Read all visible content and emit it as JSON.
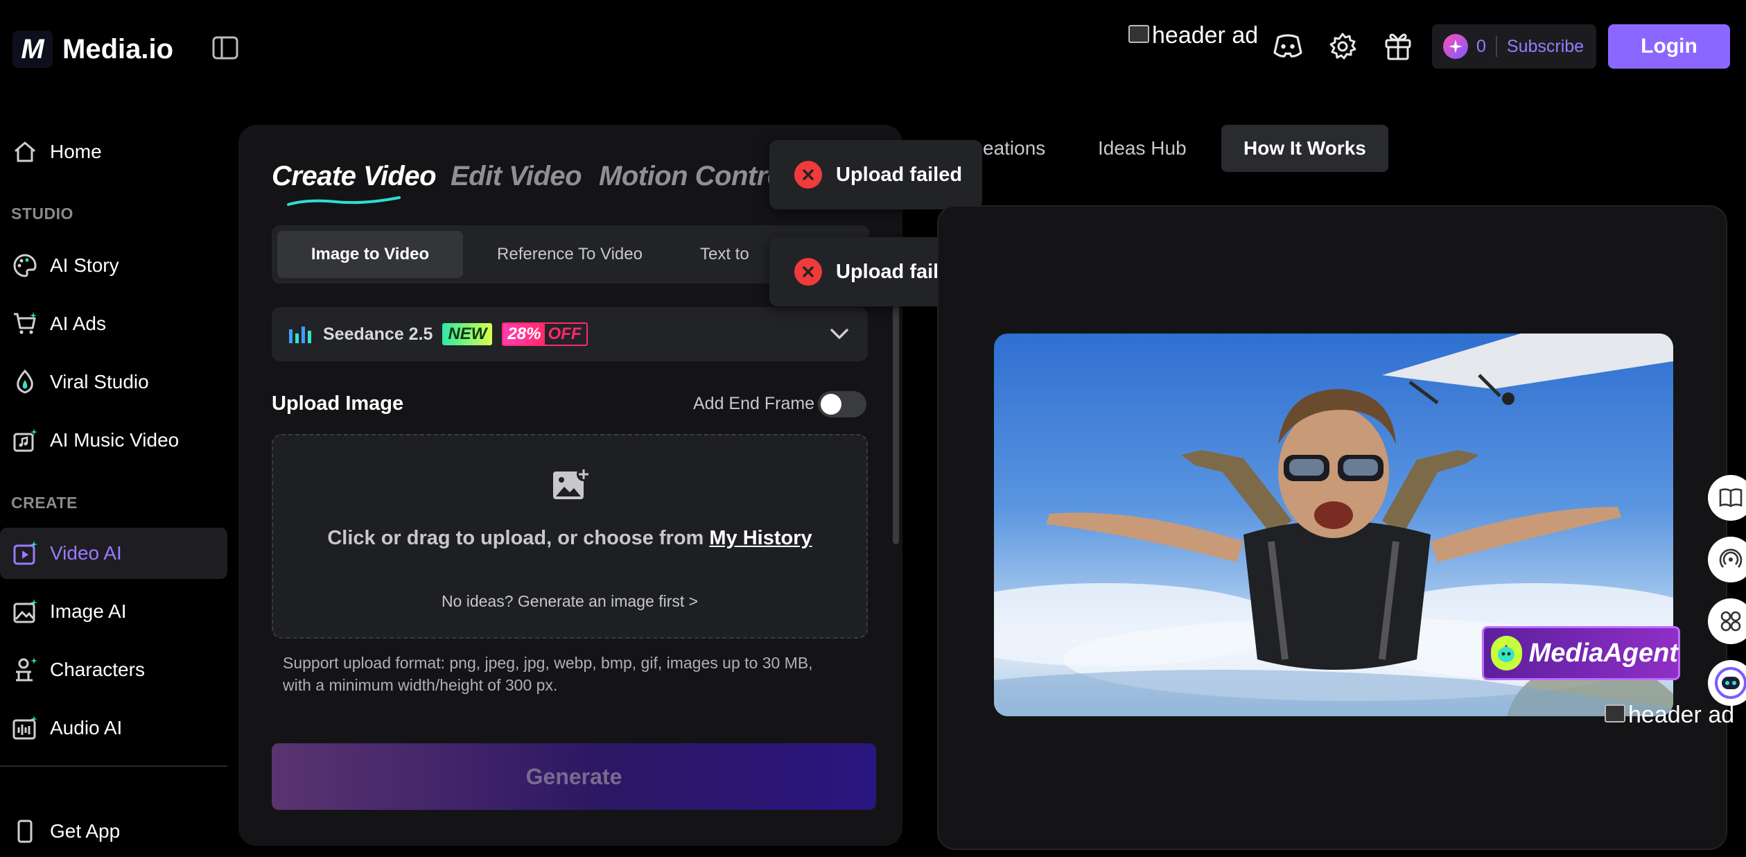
{
  "header": {
    "brand": "Media.io",
    "logo_glyph": "M",
    "ad_alt": "header ad",
    "credits": "0",
    "subscribe": "Subscribe",
    "login": "Login"
  },
  "sidebar": {
    "items_top": [
      {
        "label": "Home",
        "icon": "home-icon"
      }
    ],
    "section_studio": "STUDIO",
    "studio_items": [
      {
        "label": "AI Story",
        "icon": "palette-icon"
      },
      {
        "label": "AI Ads",
        "icon": "cart-icon"
      },
      {
        "label": "Viral Studio",
        "icon": "flame-icon"
      },
      {
        "label": "AI Music Video",
        "icon": "music-video-icon"
      }
    ],
    "section_create": "CREATE",
    "create_items": [
      {
        "label": "Video AI",
        "icon": "video-ai-icon",
        "active": true
      },
      {
        "label": "Image AI",
        "icon": "image-ai-icon"
      },
      {
        "label": "Characters",
        "icon": "characters-icon"
      },
      {
        "label": "Audio AI",
        "icon": "audio-ai-icon"
      }
    ],
    "get_app": "Get App"
  },
  "create_panel": {
    "tabs": [
      "Create Video",
      "Edit Video",
      "Motion Control"
    ],
    "active_tab": "Create Video",
    "subtabs": [
      "Image to Video",
      "Reference To Video",
      "Text to"
    ],
    "active_subtab": "Image to Video",
    "model": {
      "name": "Seedance 2.5",
      "badge_new": "NEW",
      "badge_percent": "28%",
      "badge_off": "OFF"
    },
    "upload_label": "Upload Image",
    "end_frame_label": "Add End Frame",
    "end_frame_on": false,
    "drop_text": "Click or drag to upload, or choose from",
    "drop_link": "My History",
    "no_ideas": "No ideas? Generate an image first >",
    "support_line1": "Support upload format: png, jpeg, jpg, webp, bmp, gif, images up to 30 MB,",
    "support_line2": "with a minimum width/height of 300 px.",
    "generate": "Generate"
  },
  "toasts": [
    "Upload failed",
    "Upload failed"
  ],
  "right_tabs": {
    "items": [
      "eations",
      "Ideas Hub",
      "How It Works"
    ],
    "active": "How It Works"
  },
  "preview": {
    "badge": "MediaAgent",
    "ad_alt": "header ad"
  },
  "colors": {
    "accent": "#8c67ff",
    "error": "#ef3b3b",
    "background": "#000000",
    "panel": "#141416"
  }
}
